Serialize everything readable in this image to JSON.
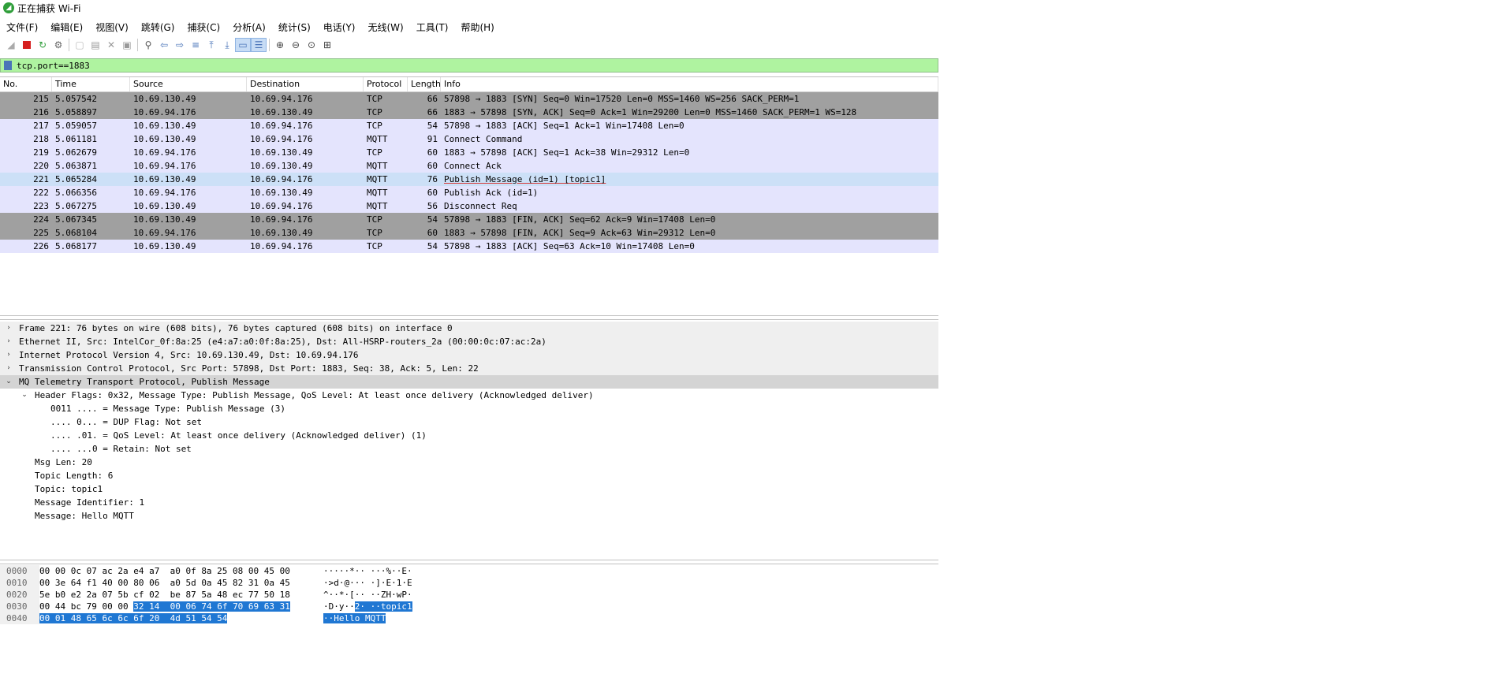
{
  "window": {
    "title": "正在捕获 Wi-Fi"
  },
  "menu": [
    "文件(F)",
    "编辑(E)",
    "视图(V)",
    "跳转(G)",
    "捕获(C)",
    "分析(A)",
    "统计(S)",
    "电话(Y)",
    "无线(W)",
    "工具(T)",
    "帮助(H)"
  ],
  "filter": {
    "value": "tcp.port==1883"
  },
  "columns": [
    "No.",
    "Time",
    "Source",
    "Destination",
    "Protocol",
    "Length",
    "Info"
  ],
  "packets": [
    {
      "no": "215",
      "time": "5.057542",
      "src": "10.69.130.49",
      "dst": "10.69.94.176",
      "proto": "TCP",
      "len": "66",
      "info": "57898 → 1883 [SYN] Seq=0 Win=17520 Len=0 MSS=1460 WS=256 SACK_PERM=1"
    },
    {
      "no": "216",
      "time": "5.058897",
      "src": "10.69.94.176",
      "dst": "10.69.130.49",
      "proto": "TCP",
      "len": "66",
      "info": "1883 → 57898 [SYN, ACK] Seq=0 Ack=1 Win=29200 Len=0 MSS=1460 SACK_PERM=1 WS=128"
    },
    {
      "no": "217",
      "time": "5.059057",
      "src": "10.69.130.49",
      "dst": "10.69.94.176",
      "proto": "TCP",
      "len": "54",
      "info": "57898 → 1883 [ACK] Seq=1 Ack=1 Win=17408 Len=0"
    },
    {
      "no": "218",
      "time": "5.061181",
      "src": "10.69.130.49",
      "dst": "10.69.94.176",
      "proto": "MQTT",
      "len": "91",
      "info": "Connect Command"
    },
    {
      "no": "219",
      "time": "5.062679",
      "src": "10.69.94.176",
      "dst": "10.69.130.49",
      "proto": "TCP",
      "len": "60",
      "info": "1883 → 57898 [ACK] Seq=1 Ack=38 Win=29312 Len=0"
    },
    {
      "no": "220",
      "time": "5.063871",
      "src": "10.69.94.176",
      "dst": "10.69.130.49",
      "proto": "MQTT",
      "len": "60",
      "info": "Connect Ack"
    },
    {
      "no": "221",
      "time": "5.065284",
      "src": "10.69.130.49",
      "dst": "10.69.94.176",
      "proto": "MQTT",
      "len": "76",
      "info": "Publish Message (id=1) [topic1]"
    },
    {
      "no": "222",
      "time": "5.066356",
      "src": "10.69.94.176",
      "dst": "10.69.130.49",
      "proto": "MQTT",
      "len": "60",
      "info": "Publish Ack (id=1)"
    },
    {
      "no": "223",
      "time": "5.067275",
      "src": "10.69.130.49",
      "dst": "10.69.94.176",
      "proto": "MQTT",
      "len": "56",
      "info": "Disconnect Req"
    },
    {
      "no": "224",
      "time": "5.067345",
      "src": "10.69.130.49",
      "dst": "10.69.94.176",
      "proto": "TCP",
      "len": "54",
      "info": "57898 → 1883 [FIN, ACK] Seq=62 Ack=9 Win=17408 Len=0"
    },
    {
      "no": "225",
      "time": "5.068104",
      "src": "10.69.94.176",
      "dst": "10.69.130.49",
      "proto": "TCP",
      "len": "60",
      "info": "1883 → 57898 [FIN, ACK] Seq=9 Ack=63 Win=29312 Len=0"
    },
    {
      "no": "226",
      "time": "5.068177",
      "src": "10.69.130.49",
      "dst": "10.69.94.176",
      "proto": "TCP",
      "len": "54",
      "info": "57898 → 1883 [ACK] Seq=63 Ack=10 Win=17408 Len=0"
    }
  ],
  "details": {
    "frame": "Frame 221: 76 bytes on wire (608 bits), 76 bytes captured (608 bits) on interface 0",
    "ethernet": "Ethernet II, Src: IntelCor_0f:8a:25 (e4:a7:a0:0f:8a:25), Dst: All-HSRP-routers_2a (00:00:0c:07:ac:2a)",
    "ip": "Internet Protocol Version 4, Src: 10.69.130.49, Dst: 10.69.94.176",
    "tcp": "Transmission Control Protocol, Src Port: 57898, Dst Port: 1883, Seq: 38, Ack: 5, Len: 22",
    "mqtt": "MQ Telemetry Transport Protocol, Publish Message",
    "header_flags": "Header Flags: 0x32, Message Type: Publish Message, QoS Level: At least once delivery (Acknowledged deliver)",
    "flag_bits": [
      "0011 .... = Message Type: Publish Message (3)",
      ".... 0... = DUP Flag: Not set",
      ".... .01. = QoS Level: At least once delivery (Acknowledged deliver) (1)",
      ".... ...0 = Retain: Not set"
    ],
    "fields": [
      "Msg Len: 20",
      "Topic Length: 6",
      "Topic: topic1",
      "Message Identifier: 1",
      "Message: Hello MQTT"
    ]
  },
  "hex": [
    {
      "off": "0000",
      "b1": "00 00 0c 07 ac 2a e4 a7",
      "b1h": "",
      "b2": "a0 0f 8a 25 08 00 45 00",
      "b2h": "",
      "a1": "·····*··",
      "a1h": "",
      "a2": " ···%··E·",
      "a2h": ""
    },
    {
      "off": "0010",
      "b1": "00 3e 64 f1 40 00 80 06",
      "b1h": "",
      "b2": "a0 5d 0a 45 82 31 0a 45",
      "b2h": "",
      "a1": "·>d·@···",
      "a1h": "",
      "a2": " ·]·E·1·E",
      "a2h": ""
    },
    {
      "off": "0020",
      "b1": "5e b0 e2 2a 07 5b cf 02",
      "b1h": "",
      "b2": "be 87 5a 48 ec 77 50 18",
      "b2h": "",
      "a1": "^··*·[··",
      "a1h": "",
      "a2": " ··ZH·wP·",
      "a2h": ""
    },
    {
      "off": "0030",
      "b1": "00 44 bc 79 00 00 ",
      "b1h": "32 14",
      "b2": "",
      "b2h": "00 06 74 6f 70 69 63 31",
      "a1": "·D·y··",
      "a1h": "2·",
      "a2": "",
      "a2h": " ··topic1"
    },
    {
      "off": "0040",
      "b1": "",
      "b1h": "00 01 48 65 6c 6c 6f 20",
      "b2": "",
      "b2h": "4d 51 54 54",
      "a1": "",
      "a1h": "··Hello ",
      "a2": "",
      "a2h": "MQTT"
    }
  ]
}
